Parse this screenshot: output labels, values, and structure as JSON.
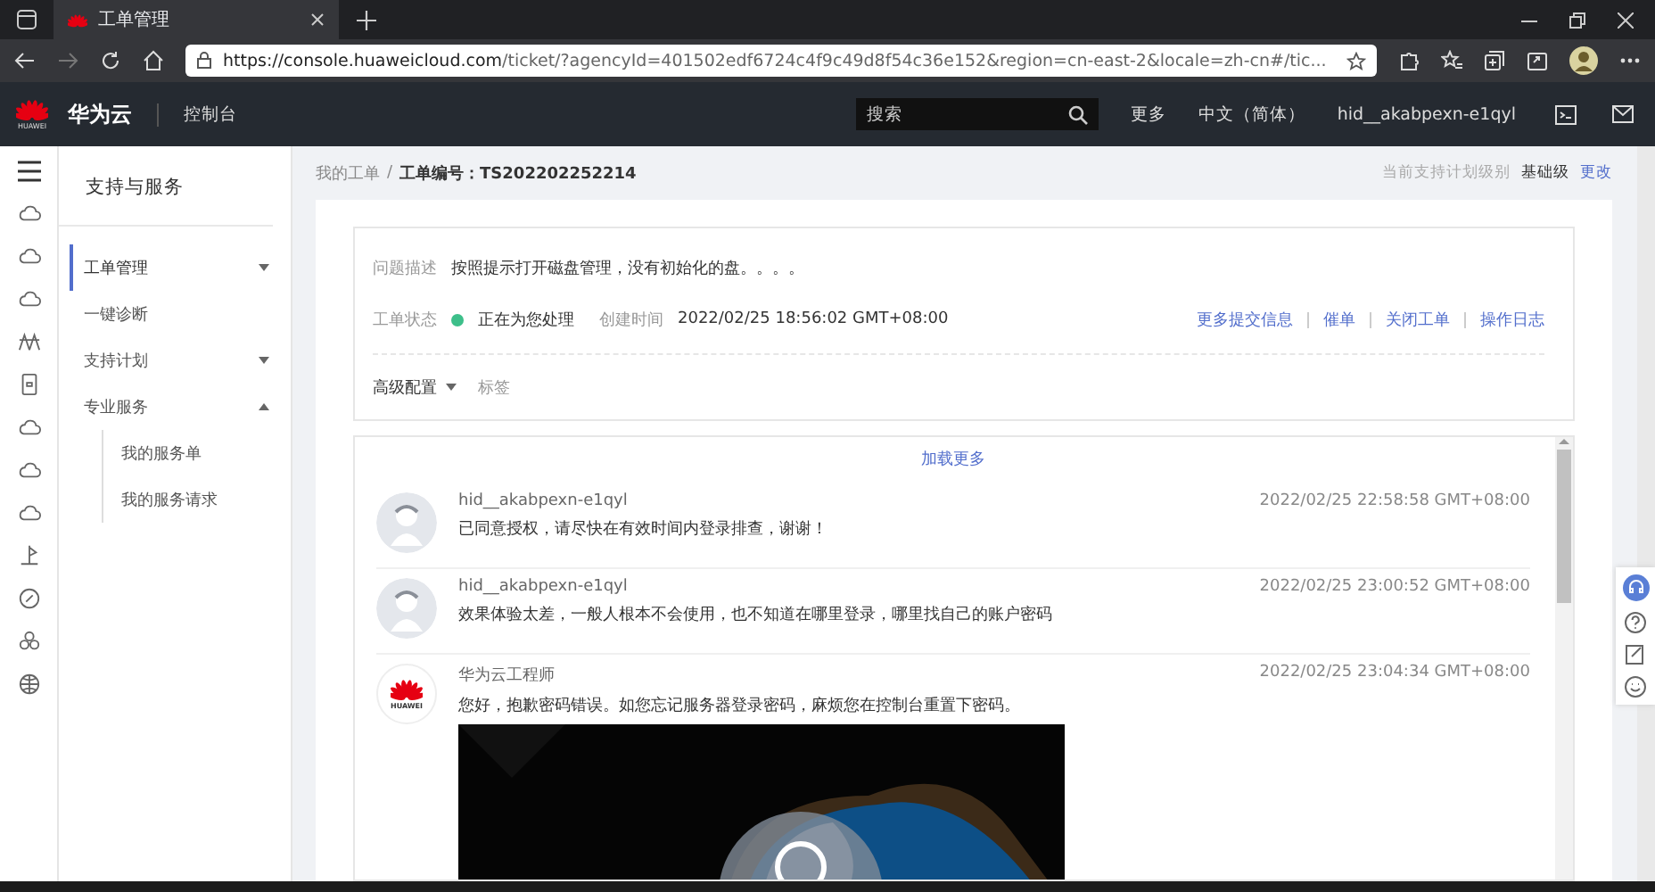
{
  "browser": {
    "tab_title": "工单管理",
    "url_host": "https://console.huaweicloud.com",
    "url_rest": "/ticket/?agencyId=401502edf6724c4f9c49d8f54c36e152&region=cn-east-2&locale=zh-cn#/tic..."
  },
  "header": {
    "logo_text": "HUAWEI",
    "brand": "华为云",
    "console": "控制台",
    "search": {
      "placeholder": "搜索"
    },
    "links": [
      "更多",
      "中文（简体）",
      "hid__akabpexn-e1qyl"
    ]
  },
  "sidebar": {
    "title": "支持与服务",
    "items": [
      {
        "label": "工单管理",
        "selected": true,
        "kind": "group",
        "expanded": false
      },
      {
        "label": "一键诊断",
        "selected": false,
        "kind": "link"
      },
      {
        "label": "支持计划",
        "selected": false,
        "kind": "group",
        "expanded": false
      },
      {
        "label": "专业服务",
        "selected": false,
        "kind": "group",
        "expanded": true,
        "children": [
          {
            "label": "我的服务单",
            "selected": false
          },
          {
            "label": "我的服务请求",
            "selected": false
          }
        ]
      }
    ]
  },
  "breadcrumb": {
    "items": [
      "我的工单",
      "工单编号：TS202202252214"
    ],
    "separator": "/"
  },
  "plan": {
    "label": "当前支持计划级别",
    "value": "基础级",
    "link": "更改"
  },
  "ticket": {
    "description_label": "问题描述",
    "description": "按照提示打开磁盘管理，没有初始化的盘。。。。",
    "status_label": "工单状态",
    "status": "正在为您处理",
    "status_indicator": {
      "color": "#3dbf8a"
    },
    "created_label": "创建时间",
    "created": "2022/02/25 18:56:02 GMT+08:00",
    "actions": [
      "更多提交信息",
      "催单",
      "关闭工单",
      "操作日志"
    ],
    "advanced": "高级配置",
    "tag": "标签"
  },
  "comments": {
    "load_more": "加载更多",
    "items": [
      {
        "kind": "user",
        "author": "hid__akabpexn-e1qyl",
        "time": "2022/02/25 22:58:58 GMT+08:00",
        "text": "已同意授权，请尽快在有效时间内登录排查，谢谢！"
      },
      {
        "kind": "user",
        "author": "hid__akabpexn-e1qyl",
        "time": "2022/02/25 23:00:52 GMT+08:00",
        "text": "效果体验太差，一般人根本不会使用，也不知道在哪里登录，哪里找自己的账户密码"
      },
      {
        "kind": "engineer",
        "logo_text": "HUAWEI",
        "author": "华为云工程师",
        "time": "2022/02/25 23:04:34 GMT+08:00",
        "text": "您好，抱歉密码错误。如您忘记服务器登录密码，麻烦您在控制台重置下密码。"
      }
    ]
  }
}
